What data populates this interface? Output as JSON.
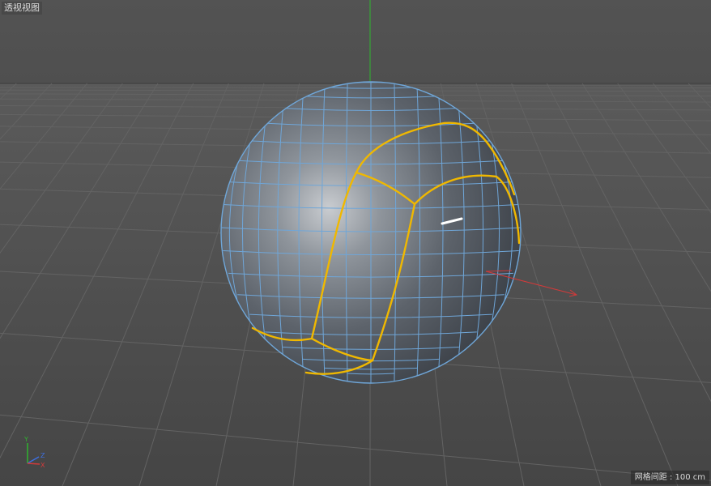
{
  "viewport": {
    "view_name": "透视视图",
    "grid_spacing_text": "网格间距 : 100 cm"
  },
  "axis_gizmo": {
    "y": "Y",
    "z": "Z",
    "x": "X"
  },
  "colors": {
    "background_top": "#505050",
    "background_bottom": "#444444",
    "grid_line": "#5f5f5f",
    "sphere_wire": "#6fa6d8",
    "selection_edge": "#f0b800",
    "y_axis": "#2fb52f",
    "x_axis": "#d23a3a",
    "z_axis": "#3d6fe0"
  }
}
